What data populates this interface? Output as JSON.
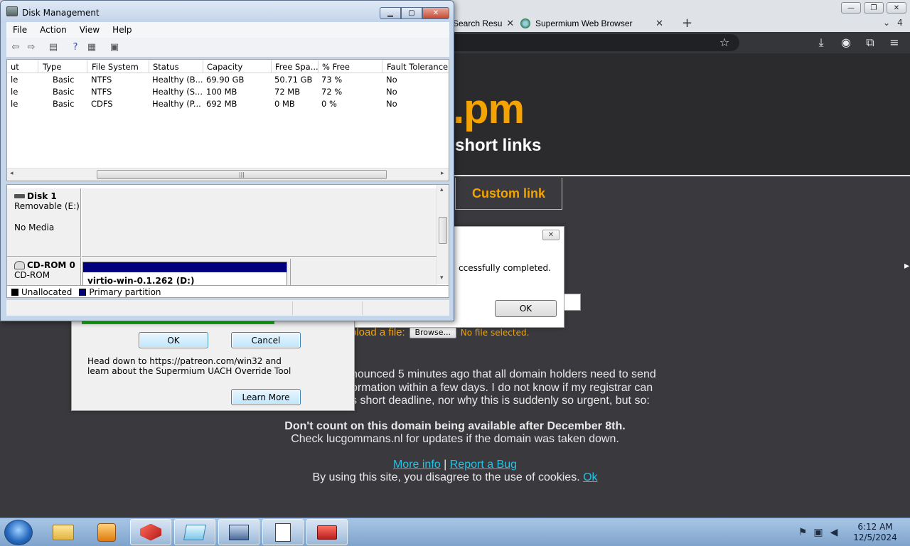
{
  "browser": {
    "tabs": [
      {
        "label": "Search Resu",
        "close": "✕"
      },
      {
        "label": "Supermium Web Browser",
        "close": "✕"
      }
    ],
    "new_tab": "+",
    "tab_count": "4",
    "window_controls": {
      "minimize": "—",
      "maximize": "❐",
      "close": "✕"
    },
    "toolbar_icons": [
      "star-icon",
      "download-icon",
      "profile-icon",
      "extensions-icon",
      "menu-icon"
    ]
  },
  "site": {
    "logo": ".pm",
    "tagline": "short links",
    "custom_link_tab": "Custom link",
    "upload_label": "pload a file:",
    "browse_button": "Browse...",
    "no_file": "No file selected.",
    "notice_lines": [
      "nounced 5 minutes ago that all domain holders need to send",
      "ormation within a few days. I do not know if my registrar can",
      "s short deadline, nor why this is suddenly so urgent, but so:"
    ],
    "warning_bold": "Don't count on this domain being available after December 8th.",
    "warning_sub": "Check lucgommans.nl for updates if the domain was taken down.",
    "more_info": "More info",
    "separator": "|",
    "report_bug": "Report a Bug",
    "cookie_text": "By using this site, you disagree to the use of cookies.",
    "cookie_ok": "Ok"
  },
  "alert_dialog": {
    "close": "✕",
    "message": "ccessfully completed.",
    "ok": "OK"
  },
  "supermium_dialog": {
    "ok": "OK",
    "cancel": "Cancel",
    "text": "Head down to https://patreon.com/win32 and learn about the Supermium UACH Override Tool",
    "learn_more": "Learn More"
  },
  "disk_management": {
    "title": "Disk Management",
    "menu": [
      "File",
      "Action",
      "View",
      "Help"
    ],
    "columns": [
      "ut",
      "Type",
      "File System",
      "Status",
      "Capacity",
      "Free Spa...",
      "% Free",
      "Fault Tolerance"
    ],
    "rows": [
      [
        "le",
        "Basic",
        "NTFS",
        "Healthy (B...",
        "69.90 GB",
        "50.71 GB",
        "73 %",
        "No"
      ],
      [
        "le",
        "Basic",
        "NTFS",
        "Healthy (S...",
        "100 MB",
        "72 MB",
        "72 %",
        "No"
      ],
      [
        "le",
        "Basic",
        "CDFS",
        "Healthy (P...",
        "692 MB",
        "0 MB",
        "0 %",
        "No"
      ]
    ],
    "disk1": {
      "name": "Disk 1",
      "type": "Removable (E:)",
      "media": "No Media"
    },
    "cdrom0": {
      "name": "CD-ROM 0",
      "type": "CD-ROM",
      "volume": "virtio-win-0.1.262  (D:)"
    },
    "legend": {
      "unallocated": "Unallocated",
      "primary": "Primary partition"
    },
    "colors": {
      "primary": "#00007f",
      "unallocated": "#000000"
    }
  },
  "taskbar": {
    "apps": [
      "explorer-icon",
      "media-player-icon",
      "app-red-icon",
      "app-notepad-icon",
      "app-computer-icon",
      "app-document-icon",
      "app-toolbox-icon"
    ],
    "time": "6:12 AM",
    "date": "12/5/2024"
  }
}
